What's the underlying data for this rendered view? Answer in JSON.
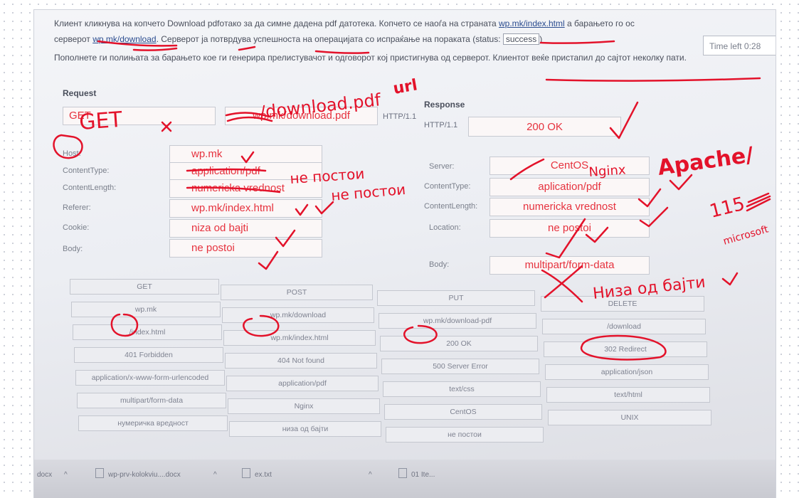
{
  "question": {
    "line1_before": "Клиент кликнува на копчето Download pdfoтакo за да симне дадена pdf датотека. Копчето се наоѓа на страната ",
    "line1_link": "wp.mk/index.html",
    "line1_after": " а барањето го ос",
    "line2_before": "серверот ",
    "line2_link": "wp.mk/download",
    "line2_middle": ". Серверот ја потврдува успешноста на операцијата со испраќање на пораката (status: ",
    "line2_status": "success",
    "line2_after": ")",
    "line3": "Пополнете ги полињата за барањето кое ги генерира прелистувачот и одговорот кој пристигнува од серверот. Клиентот веќе пристапил до сајтот неколку пати."
  },
  "timer": "Time left 0:28",
  "request": {
    "title": "Request",
    "method": "GET",
    "url": "wp.mk/download.pdf",
    "version": "HTTP/1.1",
    "fields": [
      {
        "label": "Host:",
        "value": "wp.mk"
      },
      {
        "label": "ContentType:",
        "value": "application/pdf"
      },
      {
        "label": "ContentLength:",
        "value": "numericka vrednost"
      },
      {
        "label": "Referer:",
        "value": "wp.mk/index.html"
      },
      {
        "label": "Cookie:",
        "value": "niza od bajti"
      },
      {
        "label": "Body:",
        "value": "ne postoi"
      }
    ]
  },
  "response": {
    "title": "Response",
    "version": "HTTP/1.1",
    "status": "200 OK",
    "fields": [
      {
        "label": "Server:",
        "value": "CentOS"
      },
      {
        "label": "ContentType:",
        "value": "aplication/pdf"
      },
      {
        "label": "ContentLength:",
        "value": "numericka vrednost"
      },
      {
        "label": "Location:",
        "value": "ne postoi"
      },
      {
        "label": "Body:",
        "value": "multipart/form-data"
      }
    ]
  },
  "options": [
    [
      "GET",
      "POST",
      "PUT",
      "DELETE"
    ],
    [
      "wp.mk",
      "wp.mk/download",
      "wp.mk/download-pdf",
      "/download"
    ],
    [
      "/index.html",
      "wp.mk/index.html",
      "200 OK",
      "302 Redirect"
    ],
    [
      "401 Forbidden",
      "404 Not found",
      "500 Server Error",
      "application/json"
    ],
    [
      "application/x-www-form-urlencoded",
      "application/pdf",
      "text/css",
      "text/html"
    ],
    [
      "multipart/form-data",
      "Nginx",
      "CentOS",
      "UNIX"
    ],
    [
      "нумеричка вредност",
      "низа од бајти",
      "не постои",
      ""
    ]
  ],
  "taskbar": {
    "item1": "docx",
    "item2": "wp-prv-kolokviu....docx",
    "item3": "ex.txt",
    "item4": "01 Ite..."
  },
  "handwriting": {
    "download_pdf": "/download.pdf",
    "url": "url",
    "get": "GET",
    "content_type_note": "не постои",
    "content_length_note": "не постои",
    "nginx": "Nginx",
    "apache": "Apache/",
    "num": "115",
    "microsoft": "microsoft",
    "body_note": "Низа од бајти"
  }
}
